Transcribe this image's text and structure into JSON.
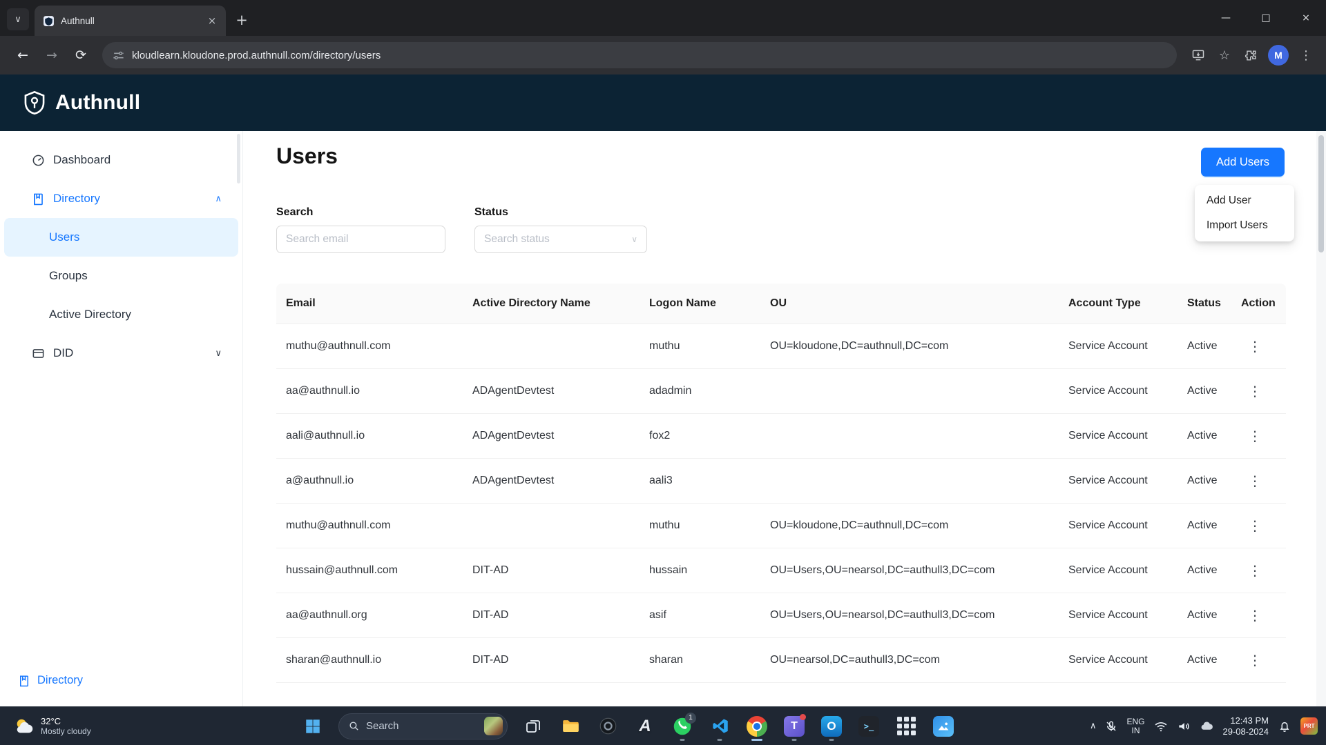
{
  "browser": {
    "tab_title": "Authnull",
    "url": "kloudlearn.kloudone.prod.authnull.com/directory/users",
    "profile_initial": "M"
  },
  "app": {
    "brand": "Authnull",
    "sidebar": {
      "items": [
        {
          "label": "Dashboard"
        },
        {
          "label": "Directory"
        },
        {
          "label": "Users"
        },
        {
          "label": "Groups"
        },
        {
          "label": "Active Directory"
        },
        {
          "label": "DID"
        }
      ],
      "footer_label": "Directory"
    },
    "page": {
      "title": "Users",
      "add_users_button": "Add Users",
      "menu_items": [
        "Add User",
        "Import Users"
      ],
      "search_label": "Search",
      "search_placeholder": "Search email",
      "status_label": "Status",
      "status_placeholder": "Search status"
    },
    "table": {
      "columns": [
        "Email",
        "Active Directory Name",
        "Logon Name",
        "OU",
        "Account Type",
        "Status",
        "Action"
      ],
      "keys": [
        "email",
        "ad_name",
        "logon_name",
        "ou",
        "account_type",
        "status"
      ],
      "rows": [
        [
          "muthu@authnull.com",
          "",
          "muthu",
          "OU=kloudone,DC=authnull,DC=com",
          "Service Account",
          "Active"
        ],
        [
          "aa@authnull.io",
          "ADAgentDevtest",
          "adadmin",
          "",
          "Service Account",
          "Active"
        ],
        [
          "aali@authnull.io",
          "ADAgentDevtest",
          "fox2",
          "",
          "Service Account",
          "Active"
        ],
        [
          "a@authnull.io",
          "ADAgentDevtest",
          "aali3",
          "",
          "Service Account",
          "Active"
        ],
        [
          "muthu@authnull.com",
          "",
          "muthu",
          "OU=kloudone,DC=authnull,DC=com",
          "Service Account",
          "Active"
        ],
        [
          "hussain@authnull.com",
          "DIT-AD",
          "hussain",
          "OU=Users,OU=nearsol,DC=authull3,DC=com",
          "Service Account",
          "Active"
        ],
        [
          "aa@authnull.org",
          "DIT-AD",
          "asif",
          "OU=Users,OU=nearsol,DC=authull3,DC=com",
          "Service Account",
          "Active"
        ],
        [
          "sharan@authnull.io",
          "DIT-AD",
          "sharan",
          "OU=nearsol,DC=authull3,DC=com",
          "Service Account",
          "Active"
        ]
      ]
    }
  },
  "taskbar": {
    "weather_temp": "32°C",
    "weather_desc": "Mostly cloudy",
    "search_text": "Search",
    "whatsapp_badge": "1",
    "lang_top": "ENG",
    "lang_bottom": "IN",
    "time": "12:43 PM",
    "date": "29-08-2024",
    "prt_label": "PRT"
  },
  "icons": {
    "kebab": "⋮",
    "more": "⋮",
    "tab_search_chevron": "∨",
    "tab_close": "×",
    "new_tab": "+",
    "minimize": "—",
    "maximize": "□",
    "close": "×",
    "back": "←",
    "forward": "→",
    "reload": "⟳",
    "star": "☆",
    "chevron_up": "∧",
    "chevron_down": "∨",
    "a_app": "A",
    "terminal_prompt": ">_"
  }
}
